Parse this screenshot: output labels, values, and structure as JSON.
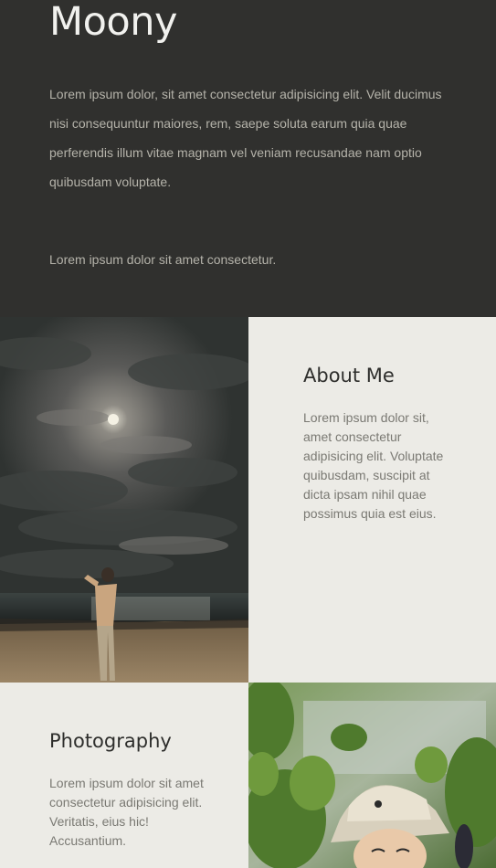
{
  "hero": {
    "title": "Moony",
    "intro": "Lorem ipsum dolor, sit amet consectetur adipisicing elit. Velit ducimus nisi consequuntur maiores, rem, saepe soluta earum quia quae perferendis illum vitae magnam vel veniam recusandae nam optio quibusdam voluptate.",
    "note": "Lorem ipsum dolor sit amet consectetur."
  },
  "about": {
    "heading": "About Me",
    "text": "Lorem ipsum dolor sit, amet consectetur adipisicing elit. Voluptate quibusdam, suscipit at dicta ipsam nihil quae possimus quia est eius."
  },
  "photography": {
    "heading": "Photography",
    "text": "Lorem ipsum dolor sit amet consectetur adipisicing elit. Veritatis, eius hic! Accusantium."
  },
  "colors": {
    "hero_background": "#30302e",
    "panel_background": "#ecebe6",
    "heading_text": "#2e2e2c",
    "body_text": "#7a7973"
  }
}
